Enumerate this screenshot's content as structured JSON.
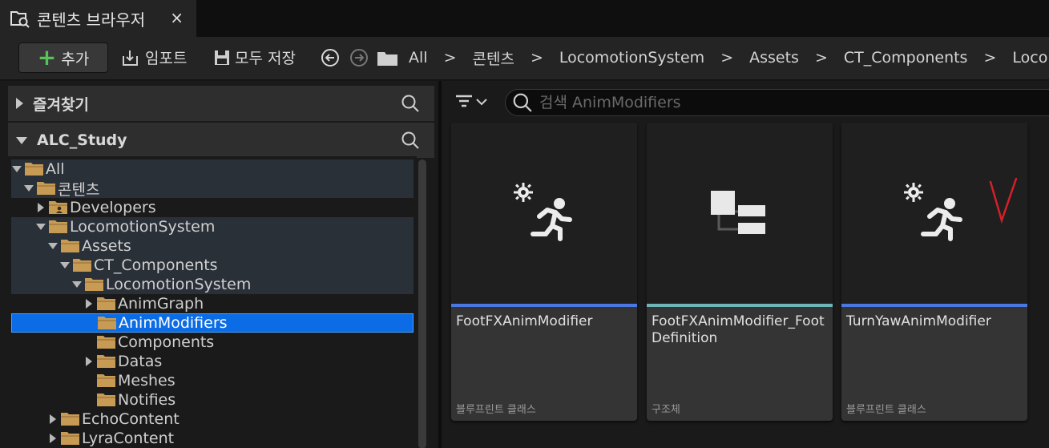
{
  "tab": {
    "title": "콘텐츠 브라우저",
    "close": "×"
  },
  "toolbar": {
    "add_label": "추가",
    "import_label": "임포트",
    "save_all_label": "모두 저장"
  },
  "breadcrumbs": [
    "All",
    "콘텐츠",
    "LocomotionSystem",
    "Assets",
    "CT_Components",
    "Locomotio"
  ],
  "breadcrumb_sep": ">",
  "favorites": {
    "label": "즐겨찾기"
  },
  "project": {
    "label": "ALC_Study"
  },
  "tree": [
    {
      "label": "All",
      "expanded": true,
      "has_children": true,
      "highlighted": true
    },
    {
      "label": "콘텐츠",
      "expanded": true,
      "has_children": true,
      "highlighted": true
    },
    {
      "label": "Developers",
      "expanded": false,
      "has_children": true,
      "highlighted": false,
      "special": "developers"
    },
    {
      "label": "LocomotionSystem",
      "expanded": true,
      "has_children": true,
      "highlighted": true
    },
    {
      "label": "Assets",
      "expanded": true,
      "has_children": true,
      "highlighted": true
    },
    {
      "label": "CT_Components",
      "expanded": true,
      "has_children": true,
      "highlighted": true
    },
    {
      "label": "LocomotionSystem",
      "expanded": true,
      "has_children": true,
      "highlighted": true
    },
    {
      "label": "AnimGraph",
      "expanded": false,
      "has_children": true,
      "highlighted": false
    },
    {
      "label": "AnimModifiers",
      "expanded": false,
      "has_children": false,
      "selected": true
    },
    {
      "label": "Components",
      "expanded": false,
      "has_children": false,
      "highlighted": false
    },
    {
      "label": "Datas",
      "expanded": false,
      "has_children": true,
      "highlighted": false
    },
    {
      "label": "Meshes",
      "expanded": false,
      "has_children": false,
      "highlighted": false
    },
    {
      "label": "Notifies",
      "expanded": false,
      "has_children": false,
      "highlighted": false
    },
    {
      "label": "EchoContent",
      "expanded": false,
      "has_children": true,
      "highlighted": false
    },
    {
      "label": "LyraContent",
      "expanded": false,
      "has_children": true,
      "highlighted": false
    }
  ],
  "search": {
    "placeholder": "검색 AnimModifiers"
  },
  "assets": [
    {
      "name": "FootFXAnimModifier",
      "type": "블루프린트 클래스",
      "bar_color": "#4a78e0",
      "icon": "anim-modifier-icon"
    },
    {
      "name": "FootFXAnimModifier_FootDefinition",
      "type": "구조체",
      "bar_color": "#6fb5b8",
      "icon": "struct-icon"
    },
    {
      "name": "TurnYawAnimModifier",
      "type": "블루프린트 클래스",
      "bar_color": "#4a78e0",
      "icon": "anim-modifier-icon"
    }
  ],
  "colors": {
    "accent": "#0b6ce6",
    "folder": "#c89b54",
    "add_plus": "#58c258"
  }
}
